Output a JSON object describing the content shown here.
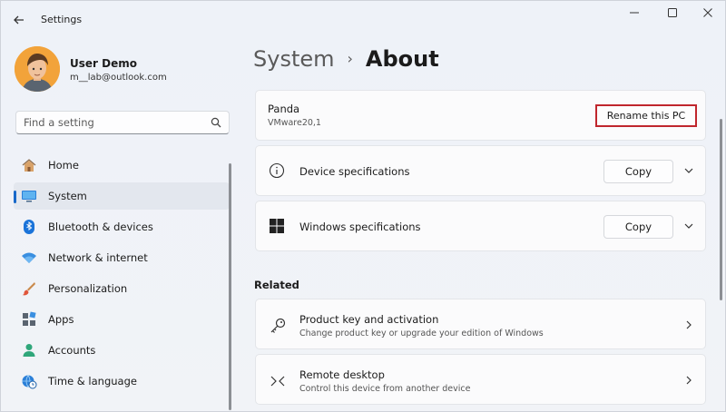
{
  "window": {
    "title": "Settings"
  },
  "user": {
    "name": "User Demo",
    "email": "m__lab@outlook.com"
  },
  "search": {
    "placeholder": "Find a setting"
  },
  "nav": {
    "items": [
      {
        "label": "Home",
        "icon": "home-icon",
        "selected": false
      },
      {
        "label": "System",
        "icon": "system-icon",
        "selected": true
      },
      {
        "label": "Bluetooth & devices",
        "icon": "bluetooth-icon",
        "selected": false
      },
      {
        "label": "Network & internet",
        "icon": "wifi-icon",
        "selected": false
      },
      {
        "label": "Personalization",
        "icon": "brush-icon",
        "selected": false
      },
      {
        "label": "Apps",
        "icon": "apps-icon",
        "selected": false
      },
      {
        "label": "Accounts",
        "icon": "person-icon",
        "selected": false
      },
      {
        "label": "Time & language",
        "icon": "globe-clock-icon",
        "selected": false
      }
    ]
  },
  "breadcrumb": {
    "parent": "System",
    "separator": "›",
    "current": "About"
  },
  "pc": {
    "name": "Panda",
    "model": "VMware20,1",
    "rename_label": "Rename this PC"
  },
  "specs": {
    "device": {
      "label": "Device specifications",
      "copy_label": "Copy"
    },
    "windows": {
      "label": "Windows specifications",
      "copy_label": "Copy"
    }
  },
  "related": {
    "title": "Related",
    "items": [
      {
        "label": "Product key and activation",
        "description": "Change product key or upgrade your edition of Windows"
      },
      {
        "label": "Remote desktop",
        "description": "Control this device from another device"
      }
    ]
  },
  "colors": {
    "accent": "#1868c9",
    "highlight_border": "#c0262d"
  }
}
